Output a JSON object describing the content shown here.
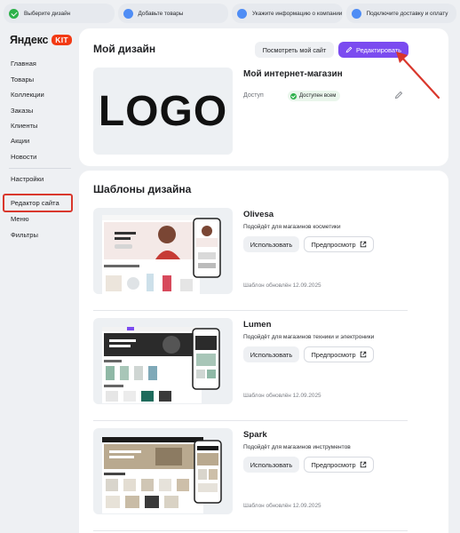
{
  "steps": [
    {
      "label": "Выберите дизайн",
      "state": "done"
    },
    {
      "label": "Добавьте товары",
      "state": "todo"
    },
    {
      "label": "Укажите информацию о компании",
      "state": "todo"
    },
    {
      "label": "Подключите доставку и оплату",
      "state": "todo"
    }
  ],
  "brand": {
    "word": "Яндекс",
    "badge": "KIT"
  },
  "sidebar": {
    "items": [
      {
        "label": "Главная"
      },
      {
        "label": "Товары"
      },
      {
        "label": "Коллекции"
      },
      {
        "label": "Заказы"
      },
      {
        "label": "Клиенты"
      },
      {
        "label": "Акции"
      },
      {
        "label": "Новости"
      },
      {
        "label": "Настройки"
      },
      {
        "label": "Редактор сайта"
      },
      {
        "label": "Меню"
      },
      {
        "label": "Фильтры"
      }
    ]
  },
  "design": {
    "title": "Мой дизайн",
    "view_button": "Посмотреть мой сайт",
    "edit_button": "Редактировать",
    "logo_text": "LOGO",
    "shop_name": "Мой интернет-магазин",
    "access_label": "Доступ",
    "access_value": "Доступен всем"
  },
  "templates": {
    "title": "Шаблоны дизайна",
    "use_label": "Использовать",
    "preview_label": "Предпросмотр",
    "items": [
      {
        "name": "Olivesa",
        "description": "Подойдёт для магазинов косметики",
        "updated": "Шаблон обновлён 12.09.2025"
      },
      {
        "name": "Lumen",
        "description": "Подойдёт для магазинов техники и электроники",
        "updated": "Шаблон обновлён 12.09.2025"
      },
      {
        "name": "Spark",
        "description": "Подойдёт для магазинов инструментов",
        "updated": "Шаблон обновлён 12.09.2025"
      }
    ]
  },
  "colors": {
    "accent": "#7b4bf0",
    "success": "#2db14a",
    "step_todo": "#4f8df5",
    "brand_red": "#f23a14",
    "annotation": "#d9372c"
  }
}
